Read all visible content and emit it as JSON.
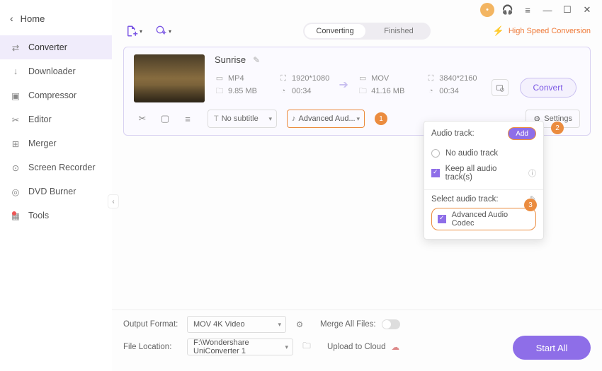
{
  "sidebar": {
    "home": "Home",
    "items": [
      {
        "label": "Converter",
        "active": true
      },
      {
        "label": "Downloader",
        "active": false
      },
      {
        "label": "Compressor",
        "active": false
      },
      {
        "label": "Editor",
        "active": false
      },
      {
        "label": "Merger",
        "active": false
      },
      {
        "label": "Screen Recorder",
        "active": false
      },
      {
        "label": "DVD Burner",
        "active": false
      },
      {
        "label": "Tools",
        "active": false
      }
    ]
  },
  "tabs": {
    "converting": "Converting",
    "finished": "Finished"
  },
  "hsc": "High Speed Conversion",
  "file": {
    "title": "Sunrise",
    "src": {
      "fmt": "MP4",
      "res": "1920*1080",
      "size": "9.85 MB",
      "dur": "00:34"
    },
    "dst": {
      "fmt": "MOV",
      "res": "3840*2160",
      "size": "41.16 MB",
      "dur": "00:34"
    },
    "subtitle_label": "No subtitle",
    "audio_label": "Advanced Aud...",
    "convert": "Convert",
    "settings": "Settings"
  },
  "steps": {
    "s1": "1",
    "s2": "2",
    "s3": "3"
  },
  "popup": {
    "title": "Audio track:",
    "add": "Add",
    "no_track": "No audio track",
    "keep_all": "Keep all audio track(s)",
    "select_label": "Select audio track:",
    "codec": "Advanced Audio Codec"
  },
  "footer": {
    "output_label": "Output Format:",
    "output_value": "MOV 4K Video",
    "merge_label": "Merge All Files:",
    "location_label": "File Location:",
    "location_value": "F:\\Wondershare UniConverter 1",
    "upload_label": "Upload to Cloud",
    "start": "Start All"
  }
}
